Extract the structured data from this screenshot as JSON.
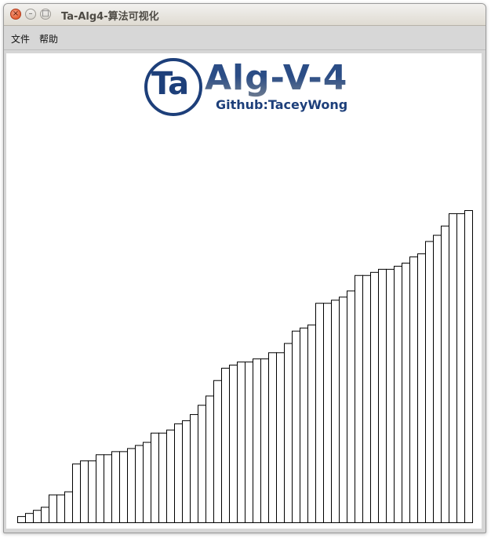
{
  "window": {
    "title": "Ta-Alg4-算法可视化",
    "close_glyph": "×",
    "min_glyph": "–",
    "max_glyph": "□"
  },
  "menu": {
    "items": [
      "文件",
      "帮助"
    ]
  },
  "logo": {
    "monogram": "Ta",
    "title": "Alg-V-4",
    "subtitle": "Github:TaceyWong",
    "color": "#1d3f7a"
  },
  "chart_data": {
    "type": "bar",
    "values": [
      2,
      3,
      4,
      5,
      9,
      9,
      10,
      19,
      20,
      20,
      22,
      22,
      23,
      23,
      24,
      25,
      26,
      29,
      29,
      30,
      32,
      33,
      35,
      38,
      41,
      46,
      50,
      51,
      52,
      52,
      53,
      53,
      55,
      55,
      58,
      62,
      63,
      64,
      71,
      71,
      72,
      73,
      75,
      80,
      80,
      81,
      82,
      82,
      83,
      84,
      86,
      87,
      91,
      93,
      96,
      100,
      100,
      101
    ],
    "max_value": 101,
    "bar_fill": "#ffffff",
    "bar_stroke": "#000000"
  }
}
